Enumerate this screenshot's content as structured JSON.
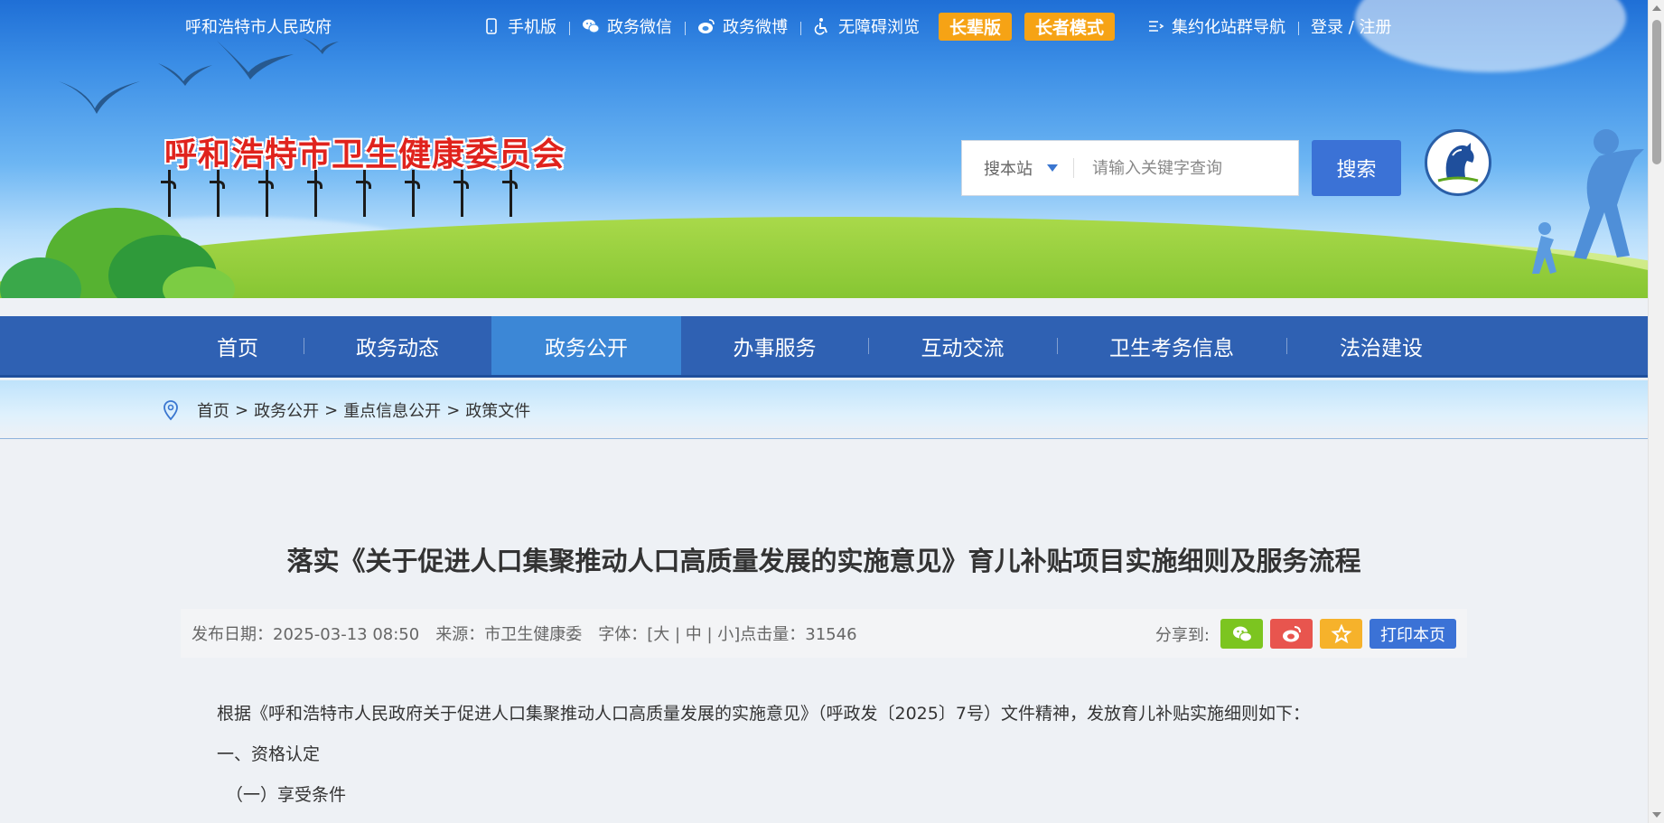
{
  "topbar": {
    "gov_link": "呼和浩特市人民政府",
    "links": [
      {
        "label": "手机版",
        "icon": "mobile-icon"
      },
      {
        "label": "政务微信",
        "icon": "wechat-icon"
      },
      {
        "label": "政务微博",
        "icon": "weibo-icon"
      },
      {
        "label": "无障碍浏览",
        "icon": "accessibility-icon"
      }
    ],
    "badge_elder_edition": "长辈版",
    "badge_elder_mode": "长者模式",
    "site_group_nav": "集约化站群导航",
    "login": "登录 / 注册"
  },
  "header": {
    "site_title": "呼和浩特市卫生健康委员会"
  },
  "search": {
    "scope": "搜本站",
    "placeholder": "请输入关键字查询",
    "button": "搜索"
  },
  "nav": {
    "items": [
      "首页",
      "政务动态",
      "政务公开",
      "办事服务",
      "互动交流",
      "卫生考务信息",
      "法治建设"
    ],
    "active": "政务公开"
  },
  "breadcrumb": [
    "首页",
    "政务公开",
    "重点信息公开",
    "政策文件"
  ],
  "article": {
    "title": "落实《关于促进人口集聚推动人口高质量发展的实施意见》育儿补贴项目实施细则及服务流程",
    "date": "发布日期：2025-03-13 08:50",
    "source": "来源：市卫生健康委",
    "font_size": "字体：[大 | 中 | 小]点击量：31546",
    "share_label": "分享到:",
    "print": "打印本页",
    "paragraphs": [
      "根据《呼和浩特市人民政府关于促进人口集聚推动人口高质量发展的实施意见》（呼政发〔2025〕7号）文件精神，发放育儿补贴实施细则如下：",
      "一、资格认定",
      "（一）享受条件"
    ]
  },
  "colors": {
    "nav_bg": "#2f61b3",
    "nav_active": "#3c87d6",
    "badge": "#f6a315",
    "title_red": "#e0231d",
    "wechat": "#7cc520",
    "weibo": "#e8554e",
    "favorite": "#f6b22b"
  }
}
